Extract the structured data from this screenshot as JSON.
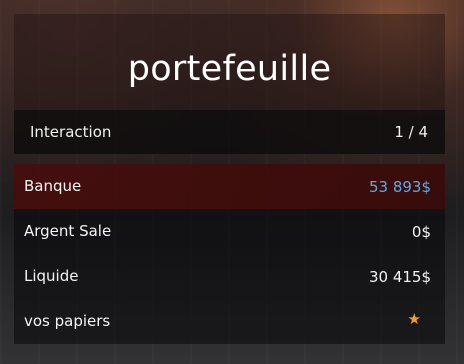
{
  "menu": {
    "title": "portefeuille",
    "subtitle": "Interaction",
    "counter": "1 / 4",
    "items": [
      {
        "label": "Banque",
        "value": "53 893$",
        "selected": true,
        "value_color": "#62a8e0"
      },
      {
        "label": "Argent Sale",
        "value": "0$",
        "selected": false
      },
      {
        "label": "Liquide",
        "value": "30 415$",
        "selected": false
      },
      {
        "label": "vos papiers",
        "icon": "star-icon",
        "icon_color": "#f0a032",
        "selected": false
      }
    ]
  },
  "colors": {
    "selected_row": "#460e0c",
    "accent_blue": "#62a8e0",
    "star": "#f0a032"
  }
}
